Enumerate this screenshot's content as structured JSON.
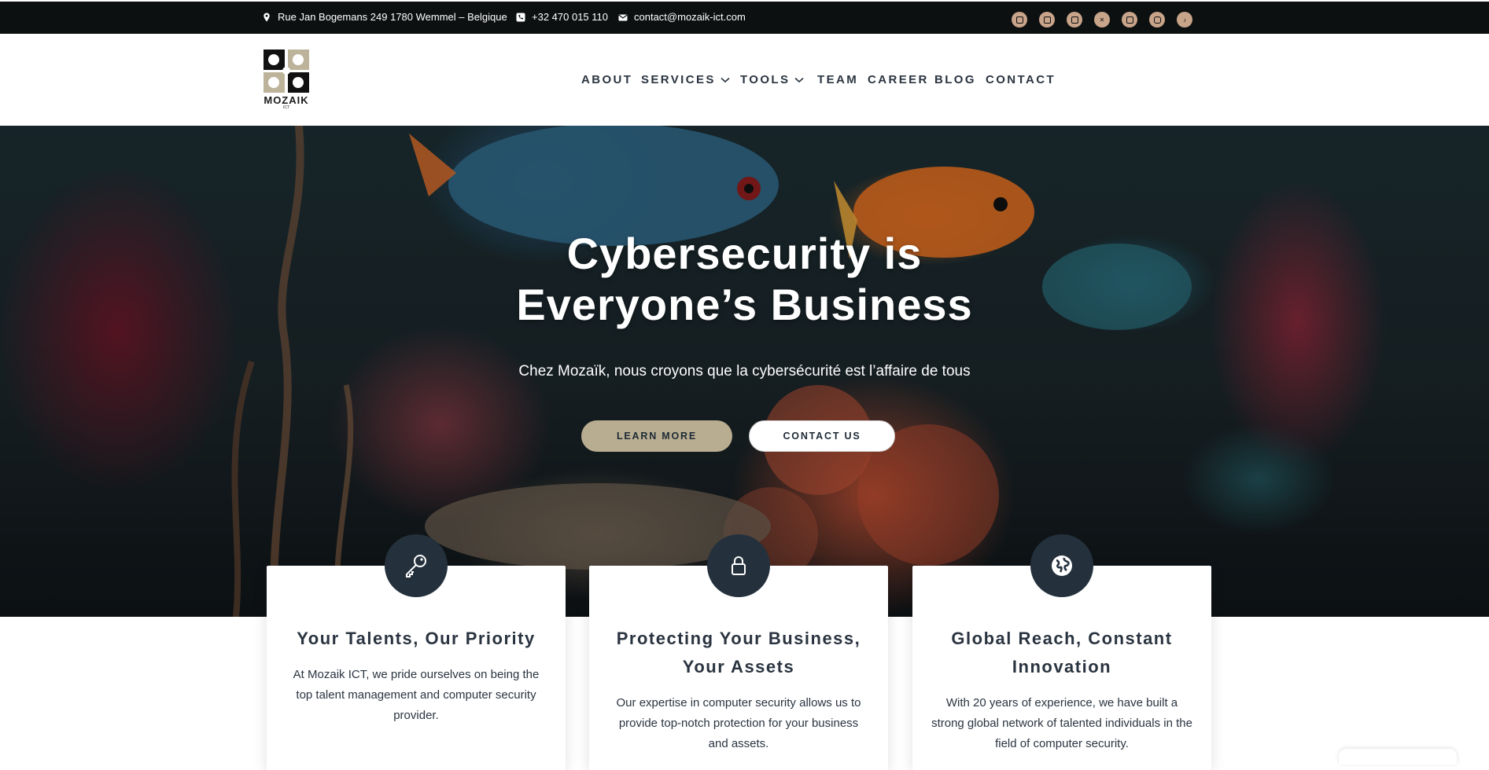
{
  "topbar": {
    "address": "Rue Jan Bogemans 249 1780 Wemmel – Belgique",
    "phone": "+32 470 015 110",
    "email": "contact@mozaik-ict.com",
    "socials": [
      "linkedin-icon",
      "youtube-icon",
      "vimeo-icon",
      "x-icon",
      "facebook-icon",
      "instagram-icon",
      "tiktok-icon"
    ],
    "social_color": "#c8a48a"
  },
  "header": {
    "logo_text": "MOZAIK",
    "logo_sub": "ICT",
    "nav": [
      {
        "label": "ABOUT"
      },
      {
        "label": "SERVICES"
      },
      {
        "label": "TOOLS"
      },
      {
        "label": "TEAM"
      },
      {
        "label": "CAREER"
      },
      {
        "label": "BLOG"
      },
      {
        "label": "CONTACT"
      }
    ]
  },
  "hero": {
    "title_line1": "Cybersecurity is",
    "title_line2": "Everyone’s Business",
    "subtitle": "Chez Mozaïk, nous croyons que la cybersécurité est l’affaire de tous",
    "learn_more": "LEARN MORE",
    "contact_us": "CONTACT US"
  },
  "cards": [
    {
      "icon": "key-icon",
      "title": "Your Talents, Our Priority",
      "text": "At Mozaik ICT, we pride ourselves on being the top talent management and computer security provider."
    },
    {
      "icon": "lock-icon",
      "title": "Protecting Your Business, Your Assets",
      "text": "Our expertise in computer security allows us to provide top-notch protection for your business and assets."
    },
    {
      "icon": "globe-icon",
      "title": "Global Reach, Constant Innovation",
      "text": "With 20 years of experience, we have built a strong global network of talented individuals in the field of computer security."
    }
  ],
  "colors": {
    "accent_button": "#b8ad90",
    "dark_navy": "#24313d",
    "topbar_bg": "#0d1011"
  }
}
